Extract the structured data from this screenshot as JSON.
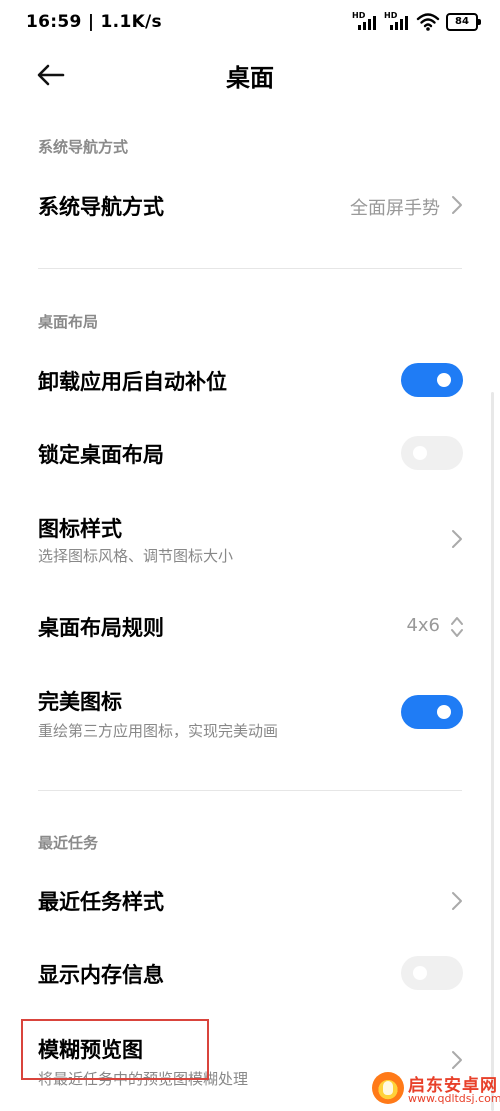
{
  "status_bar": {
    "time_speed": "16:59 | 1.1K/s",
    "signal_label_1": "HD",
    "signal_label_2": "HD",
    "battery": "84",
    "icons": [
      "signal-hd-icon",
      "signal-hd-icon",
      "wifi-icon",
      "battery-icon"
    ]
  },
  "header": {
    "title": "桌面",
    "back_icon": "back-arrow-icon"
  },
  "sections": {
    "nav": {
      "header": "系统导航方式",
      "item": {
        "title": "系统导航方式",
        "value": "全面屏手势"
      }
    },
    "layout": {
      "header": "桌面布局",
      "items": [
        {
          "title": "卸载应用后自动补位",
          "toggle": "on"
        },
        {
          "title": "锁定桌面布局",
          "toggle": "off"
        },
        {
          "title": "图标样式",
          "subtitle": "选择图标风格、调节图标大小"
        },
        {
          "title": "桌面布局规则",
          "value": "4x6"
        },
        {
          "title": "完美图标",
          "subtitle": "重绘第三方应用图标，实现完美动画",
          "toggle": "on"
        }
      ]
    },
    "recent": {
      "header": "最近任务",
      "items": [
        {
          "title": "最近任务样式"
        },
        {
          "title": "显示内存信息",
          "toggle": "off"
        },
        {
          "title": "模糊预览图",
          "subtitle": "将最近任务中的预览图模糊处理"
        }
      ]
    }
  },
  "colors": {
    "accent": "#1f7cf5",
    "highlight": "#d9443c",
    "section_header": "#8a8a8a"
  },
  "watermark": {
    "name": "启东安卓网",
    "url": "www.qdltdsj.com"
  }
}
